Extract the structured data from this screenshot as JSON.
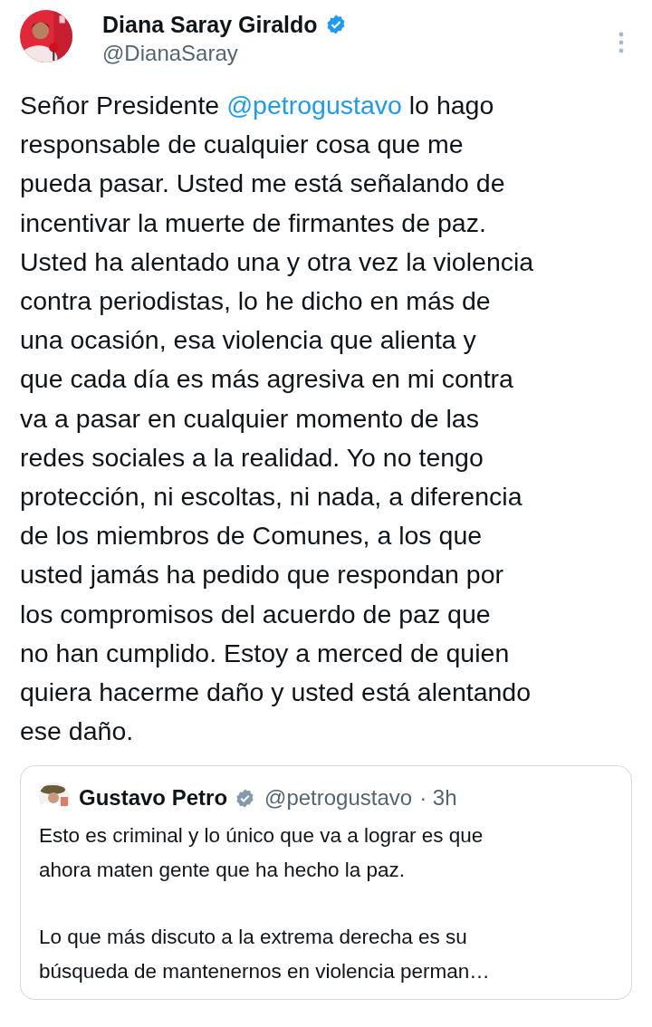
{
  "author": {
    "name": "Diana Saray Giraldo",
    "verified": true,
    "handle": "@DianaSaray"
  },
  "body": [
    {
      "kind": "text",
      "text": "Señor Presidente "
    },
    {
      "kind": "mention",
      "text": "@petrogustavo"
    },
    {
      "kind": "text",
      "text": " lo hago\nresponsable de cualquier cosa que me\npueda pasar. Usted me está señalando de\nincentivar la muerte de firmantes de paz.\nUsted ha alentado una y otra vez la violencia\ncontra periodistas, lo he dicho en más de\nuna ocasión, esa violencia que alienta y\nque cada día es más agresiva en mi contra\nva a pasar en cualquier momento de las\nredes sociales a la realidad. Yo no tengo\nprotección, ni escoltas, ni nada, a diferencia\nde los miembros de Comunes, a los que\nusted jamás ha pedido que respondan por\nlos compromisos del acuerdo de paz que\nno han cumplido. Estoy a merced de quien\nquiera hacerme daño y usted está alentando\nese daño."
    }
  ],
  "quote": {
    "name": "Gustavo Petro",
    "verified": true,
    "handle": "@petrogustavo",
    "time": "· 3h",
    "paragraphs": [
      "Esto es criminal y lo único que va a lograr es que\nahora maten gente que ha hecho la paz.",
      "Lo que más discuto a la extrema derecha es su\nbúsqueda de mantenernos en violencia perman…"
    ]
  }
}
